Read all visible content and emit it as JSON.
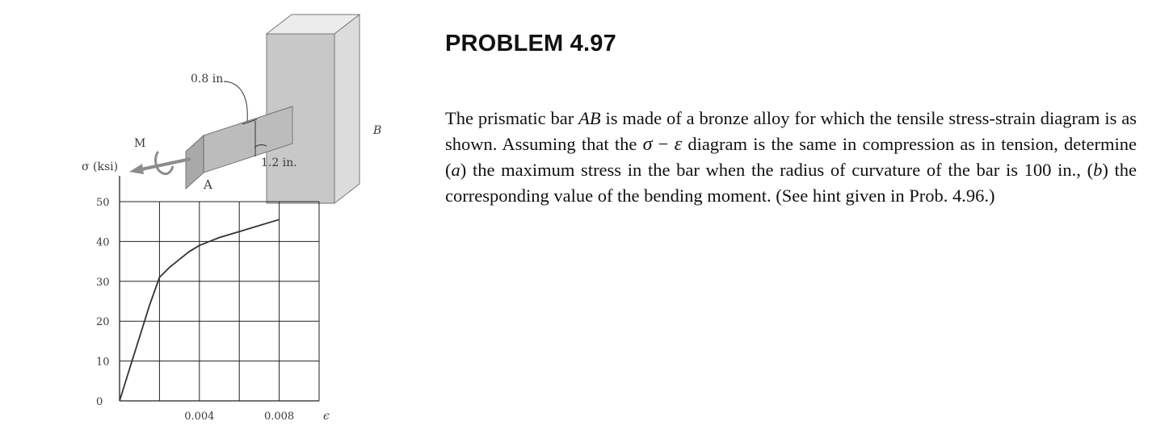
{
  "problem": {
    "title": "PROBLEM 4.97",
    "text_parts": {
      "p1": "The prismatic bar ",
      "p2": "AB",
      "p3": " is made of a bronze alloy for which the tensile stress-strain diagram is as shown. Assuming that the ",
      "sigma": "σ",
      "minus": " − ",
      "epsilon": "ε",
      "p4": " diagram is the same in compression as in tension, determine (",
      "a": "a",
      "p5": ") the maximum stress in the bar when the radius of curvature of the bar is 100 in., (",
      "b": "b",
      "p6": ") the corresponding value of the bending moment. (See hint given in Prob. 4.96.)"
    }
  },
  "figure": {
    "labels": {
      "width_dim": "0.8 in.",
      "height_dim": "1.2 in.",
      "moment": "M",
      "end_a": "A",
      "end_b": "B"
    },
    "colors": {
      "wall_front": "#c8c8c8",
      "wall_side": "#dcdcdc",
      "wall_top": "#ececec",
      "bar_top": "#ededed",
      "bar_front": "#bcbcbc",
      "bar_end": "#a9a9a9",
      "arrow": "#8c8c8c",
      "grid": "#222222",
      "curve": "#333333"
    }
  },
  "chart_data": {
    "type": "line",
    "title": "",
    "ylabel": "σ (ksi)",
    "xlabel": "ϵ",
    "xlim": [
      0,
      0.01
    ],
    "ylim": [
      0,
      50
    ],
    "x_ticks": [
      0.002,
      0.004,
      0.006,
      0.008,
      0.01
    ],
    "x_tick_labels": [
      "0.004",
      "0.008"
    ],
    "x_tick_label_values": [
      0.004,
      0.008
    ],
    "y_ticks": [
      0,
      10,
      20,
      30,
      40,
      50
    ],
    "y_tick_labels": [
      "0",
      "10",
      "20",
      "30",
      "40",
      "50"
    ],
    "grid": true,
    "series": [
      {
        "x": [
          0,
          0.0005,
          0.001,
          0.0015,
          0.002,
          0.0025,
          0.003,
          0.0035,
          0.004,
          0.005,
          0.006,
          0.007,
          0.008
        ],
        "y": [
          0,
          8,
          16,
          24,
          31,
          33.5,
          35.5,
          37.5,
          39,
          41,
          42.5,
          44,
          45.5
        ]
      }
    ]
  }
}
